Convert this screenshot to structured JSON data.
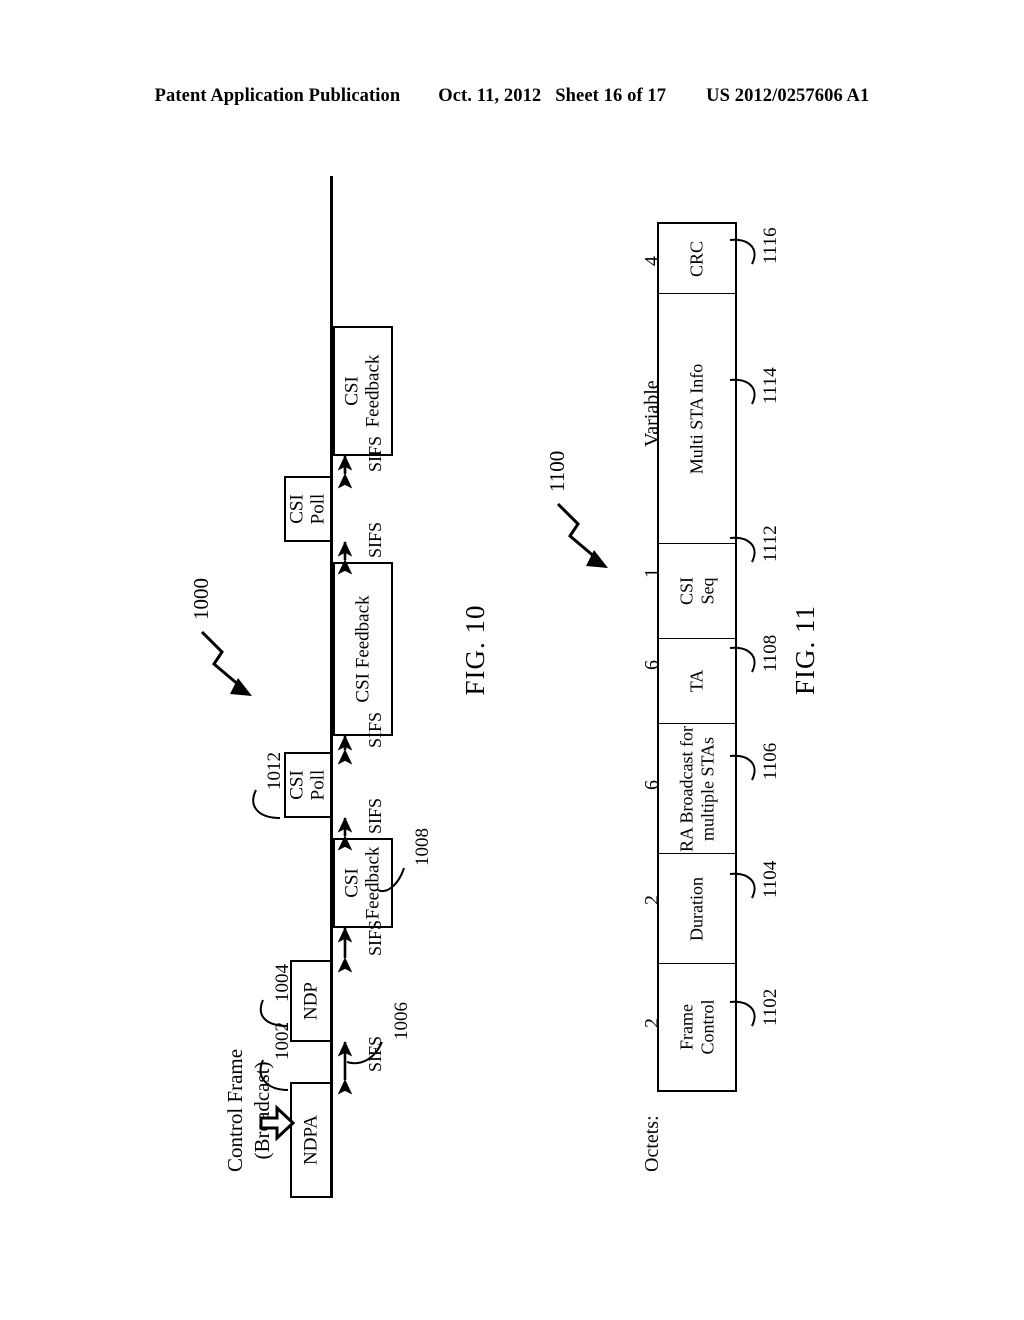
{
  "header": {
    "publication": "Patent Application Publication",
    "date": "Oct. 11, 2012",
    "sheet": "Sheet 16 of 17",
    "docnum": "US 2012/0257606 A1"
  },
  "fig10": {
    "caption": "FIG. 10",
    "ref_label": "1000",
    "annotation": {
      "line1": "Control Frame",
      "line2": "(Broadcast)"
    },
    "packets": [
      {
        "name": "ndpa",
        "label": "NDPA",
        "ref": "1002"
      },
      {
        "name": "ndp",
        "label": "NDP",
        "ref": "1004"
      },
      {
        "name": "csi-fb-1",
        "label": "CSI\nFeedback",
        "ref": "1008"
      },
      {
        "name": "csi-poll-1",
        "label": "CSI\nPoll",
        "ref": "1012"
      },
      {
        "name": "csi-fb-2",
        "label": "CSI Feedback",
        "ref": ""
      },
      {
        "name": "csi-poll-2",
        "label": "CSI\nPoll",
        "ref": ""
      },
      {
        "name": "csi-fb-3",
        "label": "CSI\nFeedback",
        "ref": ""
      }
    ],
    "sifs_gaps": [
      {
        "label": "SIFS",
        "ref": "1006"
      },
      {
        "label": "SIFS",
        "ref": ""
      },
      {
        "label": "SIFS",
        "ref": ""
      },
      {
        "label": "SIFS",
        "ref": ""
      },
      {
        "label": "SIFS",
        "ref": ""
      },
      {
        "label": "SIFS",
        "ref": ""
      }
    ]
  },
  "fig11": {
    "caption": "FIG. 11",
    "ref_label": "1100",
    "octets_label": "Octets:",
    "fields": [
      {
        "name": "frame-control",
        "label": "Frame\nControl",
        "octets": "2",
        "ref": "1102"
      },
      {
        "name": "duration",
        "label": "Duration",
        "octets": "2",
        "ref": "1104"
      },
      {
        "name": "ra",
        "label": "RA Broadcast for\nmultiple STAs",
        "octets": "6",
        "ref": "1106"
      },
      {
        "name": "ta",
        "label": "TA",
        "octets": "6",
        "ref": "1108"
      },
      {
        "name": "csi-seq",
        "label": "CSI\nSeq",
        "octets": "1",
        "ref": "1112"
      },
      {
        "name": "multi-sta-info",
        "label": "Multi STA Info",
        "octets": "Variable",
        "ref": "1114"
      },
      {
        "name": "crc",
        "label": "CRC",
        "octets": "4",
        "ref": "1116"
      }
    ]
  },
  "colors": {
    "ink": "#000000",
    "paper": "#ffffff"
  }
}
